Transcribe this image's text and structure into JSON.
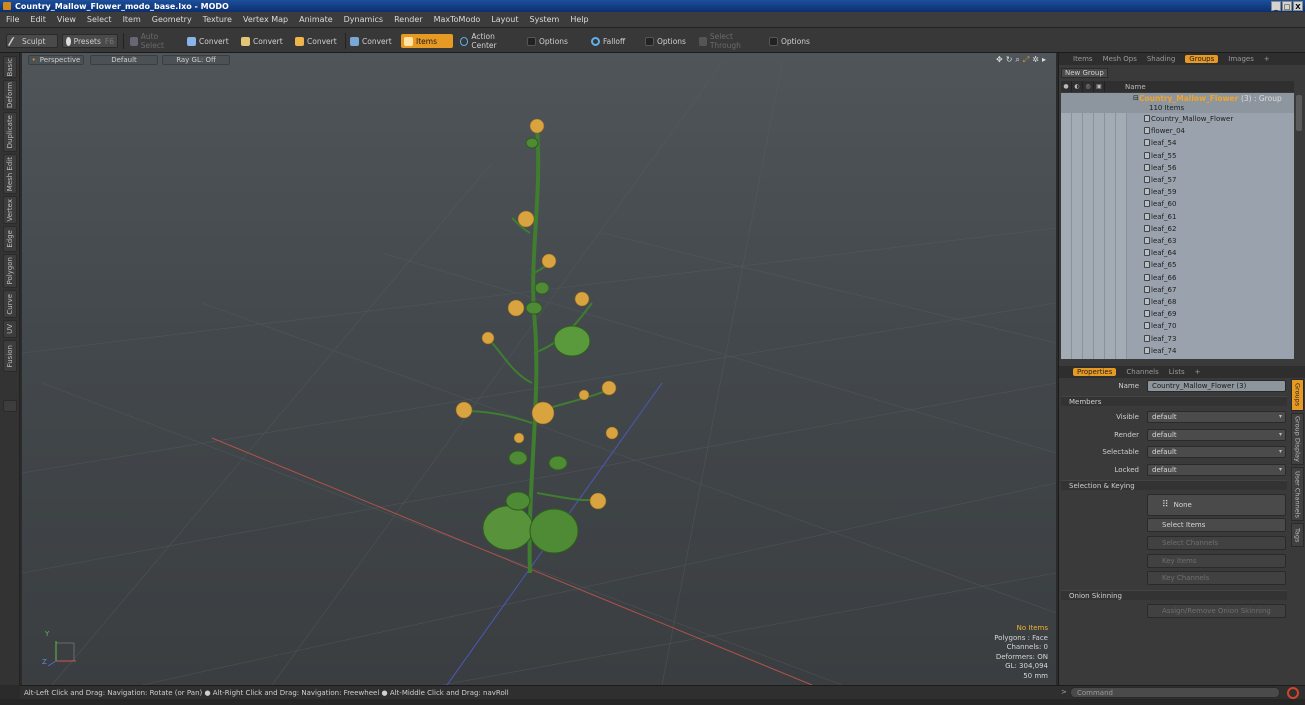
{
  "window": {
    "title": "Country_Mallow_Flower_modo_base.lxo - MODO",
    "controls": [
      "_",
      "□",
      "X"
    ]
  },
  "menu": [
    "File",
    "Edit",
    "View",
    "Select",
    "Item",
    "Geometry",
    "Texture",
    "Vertex Map",
    "Animate",
    "Dynamics",
    "Render",
    "MaxToModo",
    "Layout",
    "System",
    "Help"
  ],
  "toolbar": {
    "sculpt": "Sculpt",
    "presets": "Presets",
    "presets_key": "F6",
    "auto_select": "Auto Select",
    "convert1": "Convert",
    "convert2": "Convert",
    "convert3": "Convert",
    "convert4": "Convert",
    "items": "Items",
    "action_center": "Action Center",
    "options1": "Options",
    "falloff": "Falloff",
    "options2": "Options",
    "select_through": "Select Through",
    "options3": "Options"
  },
  "left_tabs": [
    "Basic",
    "Deform",
    "Duplicate",
    "Mesh Edit",
    "Vertex",
    "Edge",
    "Polygon",
    "Curve",
    "UV",
    "Fusion"
  ],
  "viewport": {
    "view": "Perspective",
    "shading": "Default",
    "raygl": "Ray GL: Off",
    "info": {
      "items": "No Items",
      "polygons": "Polygons : Face",
      "channels": "Channels: 0",
      "deformers": "Deformers: ON",
      "gl": "GL: 304,094",
      "scale": "50 mm"
    },
    "axis_y": "Y",
    "axis_z": "Z"
  },
  "status": "Alt-Left Click and Drag: Navigation: Rotate (or Pan) ● Alt-Right Click and Drag: Navigation: Freewheel ● Alt-Middle Click and Drag: navRoll",
  "groups_panel": {
    "tabs": [
      "Items",
      "Mesh Ops",
      "Shading",
      "Groups",
      "Images",
      "+"
    ],
    "new_group": "New Group",
    "name_header": "Name",
    "group_name": "Country_Mallow_Flower",
    "group_suffix": "(3) : Group",
    "group_count": "110 Items",
    "items": [
      "Country_Mallow_Flower",
      "flower_04",
      "leaf_54",
      "leaf_55",
      "leaf_56",
      "leaf_57",
      "leaf_59",
      "leaf_60",
      "leaf_61",
      "leaf_62",
      "leaf_63",
      "leaf_64",
      "leaf_65",
      "leaf_66",
      "leaf_67",
      "leaf_68",
      "leaf_69",
      "leaf_70",
      "leaf_73",
      "leaf_74"
    ]
  },
  "properties_panel": {
    "tabs": [
      "Properties",
      "Channels",
      "Lists",
      "+"
    ],
    "name_label": "Name",
    "name_value": "Country_Mallow_Flower (3)",
    "members": "Members",
    "visible_label": "Visible",
    "visible_value": "default",
    "render_label": "Render",
    "render_value": "default",
    "selectable_label": "Selectable",
    "selectable_value": "default",
    "locked_label": "Locked",
    "locked_value": "default",
    "sel_keying": "Selection & Keying",
    "none": "None",
    "select_items": "Select Items",
    "select_channels": "Select Channels",
    "key_items": "Key Items",
    "key_channels": "Key Channels",
    "onion": "Onion Skinning",
    "assign_onion": "Assign/Remove Onion Skinning",
    "side_tabs": [
      "Groups",
      "Group Display",
      "User Channels",
      "Tags"
    ]
  },
  "command": {
    "placeholder": "Command"
  },
  "colors": {
    "accent": "#e79a23",
    "record": "#d3452b"
  }
}
